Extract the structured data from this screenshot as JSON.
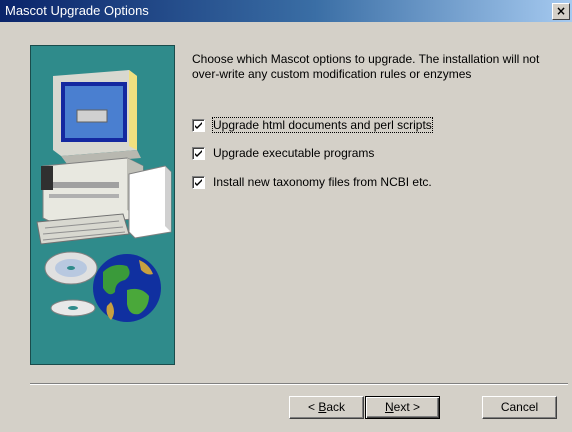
{
  "window": {
    "title": "Mascot Upgrade Options",
    "close_glyph": "×"
  },
  "illustration": {
    "name": "computer-and-globe-artwork",
    "bg_color": "#2f8b8b"
  },
  "instructions": "Choose which Mascot options to upgrade. The installation will not over-write any custom modification rules or enzymes",
  "options": [
    {
      "label": "Upgrade html documents and perl scripts",
      "checked": true,
      "focused": true
    },
    {
      "label": "Upgrade executable programs",
      "checked": true,
      "focused": false
    },
    {
      "label": "Install new taxonomy files from NCBI etc.",
      "checked": true,
      "focused": false
    }
  ],
  "buttons": {
    "back": {
      "prefix": "< ",
      "mnemonic": "B",
      "rest": "ack"
    },
    "next": {
      "mnemonic": "N",
      "rest": "ext >"
    },
    "cancel": "Cancel"
  }
}
